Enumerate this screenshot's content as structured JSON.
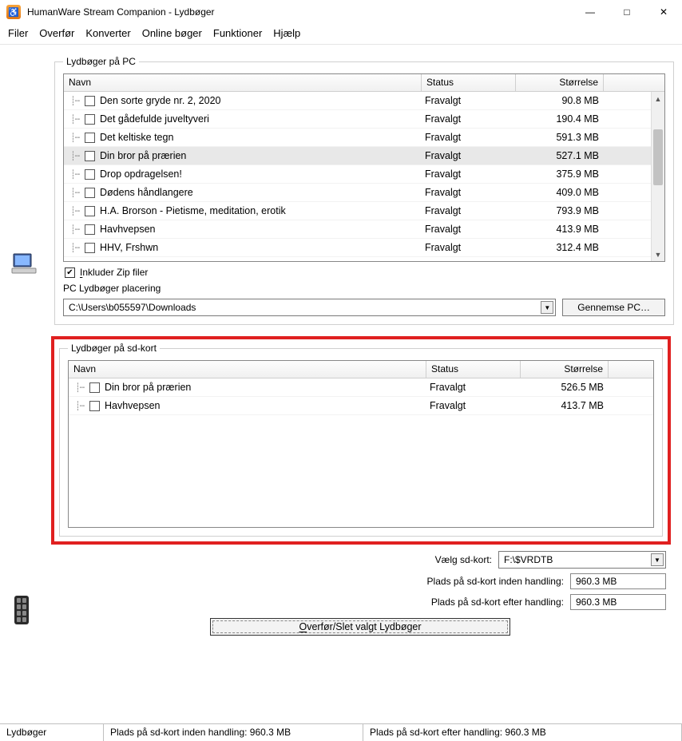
{
  "window": {
    "title": "HumanWare Stream Companion - Lydbøger",
    "app_icon_text": "♿"
  },
  "menu": {
    "items": [
      "Filer",
      "Overfør",
      "Konverter",
      "Online bøger",
      "Funktioner",
      "Hjælp"
    ]
  },
  "pc_group": {
    "legend": "Lydbøger på PC",
    "columns": {
      "name": "Navn",
      "status": "Status",
      "size": "Størrelse"
    },
    "rows": [
      {
        "name": "Den sorte gryde nr. 2, 2020",
        "status": "Fravalgt",
        "size": "90.8 MB"
      },
      {
        "name": "Det gådefulde juveltyveri",
        "status": "Fravalgt",
        "size": "190.4 MB"
      },
      {
        "name": "Det keltiske tegn",
        "status": "Fravalgt",
        "size": "591.3 MB"
      },
      {
        "name": "Din bror på prærien",
        "status": "Fravalgt",
        "size": "527.1 MB",
        "selected": true
      },
      {
        "name": "Drop opdragelsen!",
        "status": "Fravalgt",
        "size": "375.9 MB"
      },
      {
        "name": "Dødens håndlangere",
        "status": "Fravalgt",
        "size": "409.0 MB"
      },
      {
        "name": "H.A. Brorson - Pietisme, meditation,  erotik",
        "status": "Fravalgt",
        "size": "793.9 MB"
      },
      {
        "name": "Havhvepsen",
        "status": "Fravalgt",
        "size": "413.9 MB"
      },
      {
        "name": "HHV, Frshwn",
        "status": "Fravalgt",
        "size": "312.4 MB"
      }
    ],
    "include_zip_label": "Inkluder Zip filer",
    "location_label": "PC Lydbøger placering",
    "location_value": "C:\\Users\\b055597\\Downloads",
    "browse_button": "Gennemse PC…"
  },
  "sd_group": {
    "legend": "Lydbøger på sd-kort",
    "columns": {
      "name": "Navn",
      "status": "Status",
      "size": "Størrelse"
    },
    "rows": [
      {
        "name": "Din bror på prærien",
        "status": "Fravalgt",
        "size": "526.5 MB"
      },
      {
        "name": "Havhvepsen",
        "status": "Fravalgt",
        "size": "413.7 MB"
      }
    ]
  },
  "sd_controls": {
    "choose_label": "Vælg sd-kort:",
    "choose_value": "F:\\$VRDTB",
    "space_before_label": "Plads på sd-kort inden handling:",
    "space_before_value": "960.3 MB",
    "space_after_label": "Plads på sd-kort efter handling:",
    "space_after_value": "960.3 MB"
  },
  "main_action": {
    "label": "Overfør/Slet valgt Lydbøger"
  },
  "statusbar": {
    "c1": "Lydbøger",
    "c2": "Plads på sd-kort inden handling: 960.3 MB",
    "c3": "Plads på sd-kort efter handling: 960.3 MB"
  }
}
